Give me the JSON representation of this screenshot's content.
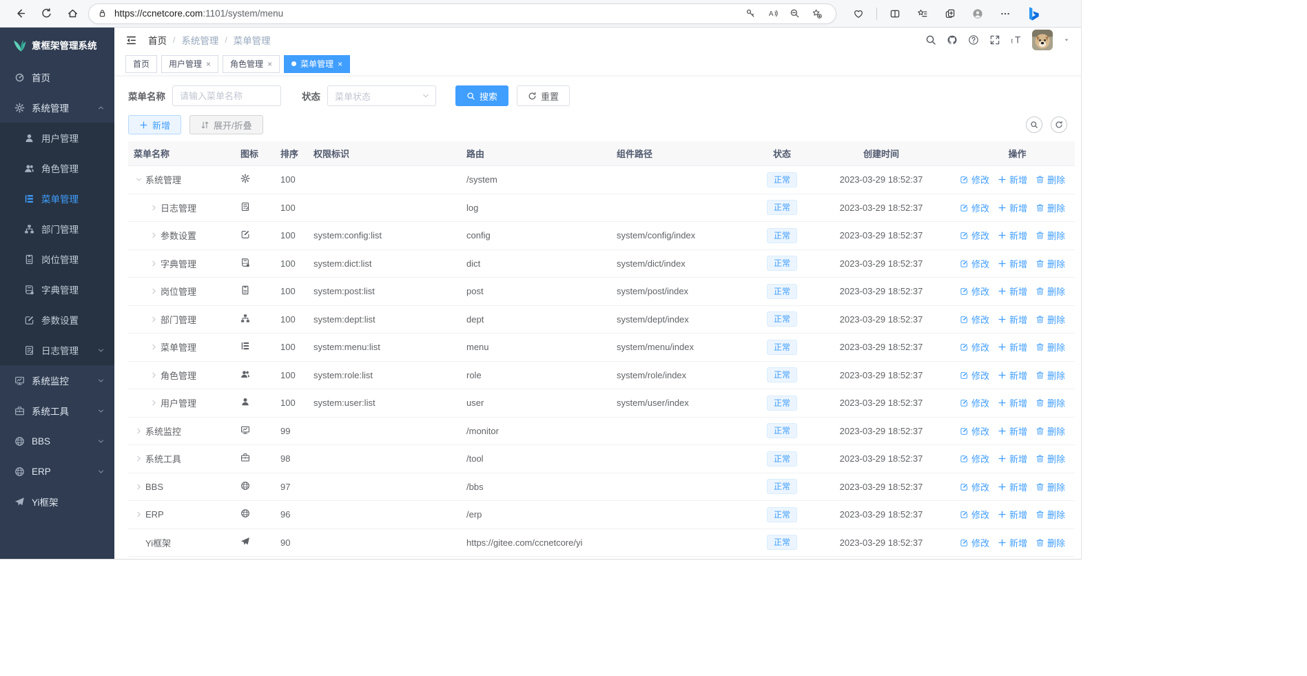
{
  "browser": {
    "url_host": "https://ccnetcore.com",
    "url_path": ":1101/system/menu"
  },
  "app": {
    "title": "意框架管理系统",
    "breadcrumb": [
      "首页",
      "系统管理",
      "菜单管理"
    ],
    "tabs": [
      {
        "label": "首页",
        "active": false,
        "closable": false
      },
      {
        "label": "用户管理",
        "active": false,
        "closable": true
      },
      {
        "label": "角色管理",
        "active": false,
        "closable": true
      },
      {
        "label": "菜单管理",
        "active": true,
        "closable": true
      }
    ]
  },
  "sidebar": {
    "items": [
      {
        "label": "首页",
        "icon": "dashboard-icon",
        "level": 0
      },
      {
        "label": "系统管理",
        "icon": "gear-icon",
        "level": 0,
        "chevron": "up"
      },
      {
        "label": "用户管理",
        "icon": "user-icon",
        "level": 1
      },
      {
        "label": "角色管理",
        "icon": "users-icon",
        "level": 1
      },
      {
        "label": "菜单管理",
        "icon": "menu-list-icon",
        "level": 1,
        "active": true
      },
      {
        "label": "部门管理",
        "icon": "org-tree-icon",
        "level": 1
      },
      {
        "label": "岗位管理",
        "icon": "post-badge-icon",
        "level": 1
      },
      {
        "label": "字典管理",
        "icon": "dict-book-icon",
        "level": 1
      },
      {
        "label": "参数设置",
        "icon": "edit-square-icon",
        "level": 1
      },
      {
        "label": "日志管理",
        "icon": "log-icon",
        "level": 1,
        "chevron": "down"
      },
      {
        "label": "系统监控",
        "icon": "monitor-icon",
        "level": 0,
        "chevron": "down"
      },
      {
        "label": "系统工具",
        "icon": "toolbox-icon",
        "level": 0,
        "chevron": "down"
      },
      {
        "label": "BBS",
        "icon": "globe-icon",
        "level": 0,
        "chevron": "down"
      },
      {
        "label": "ERP",
        "icon": "globe-icon",
        "level": 0,
        "chevron": "down"
      },
      {
        "label": "Yi框架",
        "icon": "plane-icon",
        "level": 0
      }
    ]
  },
  "filters": {
    "name_label": "菜单名称",
    "name_placeholder": "请输入菜单名称",
    "status_label": "状态",
    "status_placeholder": "菜单状态",
    "search_label": "搜索",
    "reset_label": "重置"
  },
  "toolbar": {
    "add_label": "新增",
    "toggle_label": "展开/折叠"
  },
  "table": {
    "columns": [
      "菜单名称",
      "图标",
      "排序",
      "权限标识",
      "路由",
      "组件路径",
      "状态",
      "创建时间",
      "操作"
    ],
    "action_labels": [
      "修改",
      "新增",
      "删除"
    ],
    "rows": [
      {
        "name": "系统管理",
        "icon": "gear-icon",
        "level": 0,
        "arrow": "down",
        "sort": "100",
        "perms": "",
        "path": "/system",
        "component": "",
        "status": "正常",
        "created": "2023-03-29 18:52:37"
      },
      {
        "name": "日志管理",
        "icon": "log-icon",
        "level": 1,
        "arrow": "right",
        "sort": "100",
        "perms": "",
        "path": "log",
        "component": "",
        "status": "正常",
        "created": "2023-03-29 18:52:37"
      },
      {
        "name": "参数设置",
        "icon": "edit-square-icon",
        "level": 1,
        "arrow": "right",
        "sort": "100",
        "perms": "system:config:list",
        "path": "config",
        "component": "system/config/index",
        "status": "正常",
        "created": "2023-03-29 18:52:37"
      },
      {
        "name": "字典管理",
        "icon": "dict-book-icon",
        "level": 1,
        "arrow": "right",
        "sort": "100",
        "perms": "system:dict:list",
        "path": "dict",
        "component": "system/dict/index",
        "status": "正常",
        "created": "2023-03-29 18:52:37"
      },
      {
        "name": "岗位管理",
        "icon": "post-badge-icon",
        "level": 1,
        "arrow": "right",
        "sort": "100",
        "perms": "system:post:list",
        "path": "post",
        "component": "system/post/index",
        "status": "正常",
        "created": "2023-03-29 18:52:37"
      },
      {
        "name": "部门管理",
        "icon": "org-tree-icon",
        "level": 1,
        "arrow": "right",
        "sort": "100",
        "perms": "system:dept:list",
        "path": "dept",
        "component": "system/dept/index",
        "status": "正常",
        "created": "2023-03-29 18:52:37"
      },
      {
        "name": "菜单管理",
        "icon": "menu-list-icon",
        "level": 1,
        "arrow": "right",
        "sort": "100",
        "perms": "system:menu:list",
        "path": "menu",
        "component": "system/menu/index",
        "status": "正常",
        "created": "2023-03-29 18:52:37"
      },
      {
        "name": "角色管理",
        "icon": "users-icon",
        "level": 1,
        "arrow": "right",
        "sort": "100",
        "perms": "system:role:list",
        "path": "role",
        "component": "system/role/index",
        "status": "正常",
        "created": "2023-03-29 18:52:37"
      },
      {
        "name": "用户管理",
        "icon": "user-icon",
        "level": 1,
        "arrow": "right",
        "sort": "100",
        "perms": "system:user:list",
        "path": "user",
        "component": "system/user/index",
        "status": "正常",
        "created": "2023-03-29 18:52:37"
      },
      {
        "name": "系统监控",
        "icon": "monitor-icon",
        "level": 0,
        "arrow": "right",
        "sort": "99",
        "perms": "",
        "path": "/monitor",
        "component": "",
        "status": "正常",
        "created": "2023-03-29 18:52:37"
      },
      {
        "name": "系统工具",
        "icon": "toolbox-icon",
        "level": 0,
        "arrow": "right",
        "sort": "98",
        "perms": "",
        "path": "/tool",
        "component": "",
        "status": "正常",
        "created": "2023-03-29 18:52:37"
      },
      {
        "name": "BBS",
        "icon": "globe-icon",
        "level": 0,
        "arrow": "right",
        "sort": "97",
        "perms": "",
        "path": "/bbs",
        "component": "",
        "status": "正常",
        "created": "2023-03-29 18:52:37"
      },
      {
        "name": "ERP",
        "icon": "globe-icon",
        "level": 0,
        "arrow": "right",
        "sort": "96",
        "perms": "",
        "path": "/erp",
        "component": "",
        "status": "正常",
        "created": "2023-03-29 18:52:37"
      },
      {
        "name": "Yi框架",
        "icon": "plane-icon",
        "level": 0,
        "arrow": "none",
        "sort": "90",
        "perms": "",
        "path": "https://gitee.com/ccnetcore/yi",
        "component": "",
        "status": "正常",
        "created": "2023-03-29 18:52:37"
      }
    ]
  },
  "colors": {
    "accent": "#409eff",
    "sidebar_bg": "#2f3c51",
    "submenu_bg": "#273342",
    "status_tag_bg": "#ecf5ff",
    "status_tag_border": "#d9ecff",
    "table_header_bg": "#f8f8f9"
  }
}
